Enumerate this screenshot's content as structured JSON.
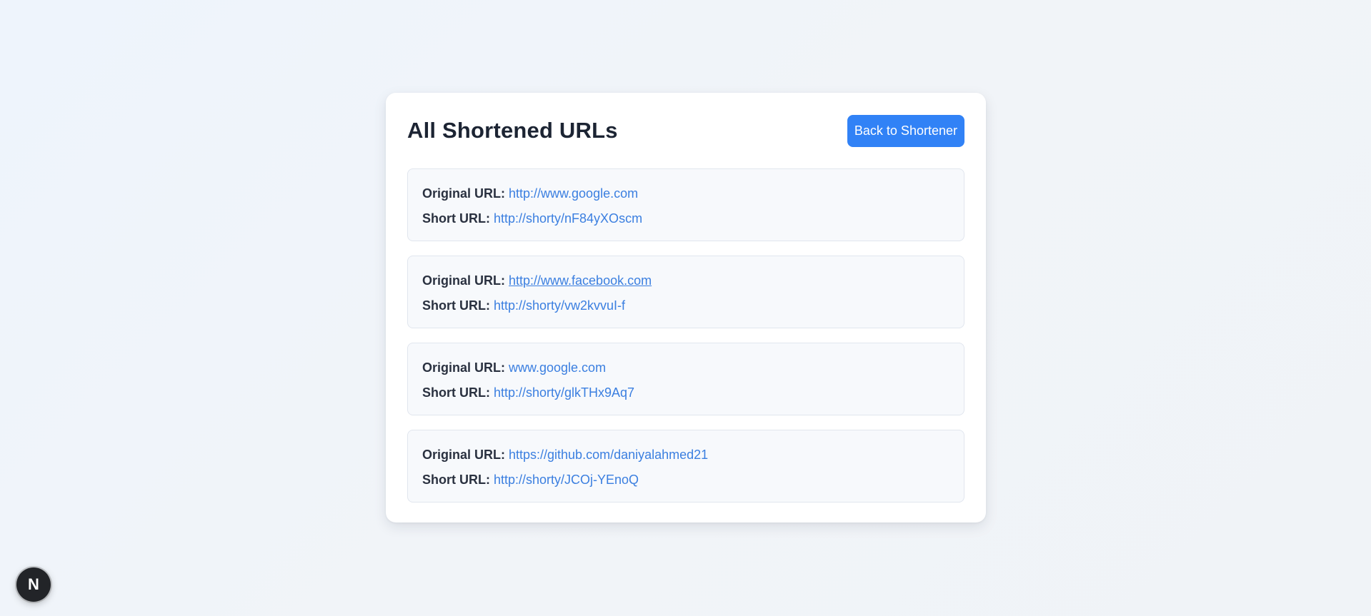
{
  "header": {
    "title": "All Shortened URLs",
    "back_button_label": "Back to Shortener"
  },
  "labels": {
    "original": "Original URL:",
    "short": "Short URL:"
  },
  "urls": [
    {
      "original": "http://www.google.com",
      "short": "http://shorty/nF84yXOscm"
    },
    {
      "original": "http://www.facebook.com",
      "short": "http://shorty/vw2kvvuI-f"
    },
    {
      "original": "www.google.com",
      "short": "http://shorty/glkTHx9Aq7"
    },
    {
      "original": "https://github.com/daniyalahmed21",
      "short": "http://shorty/JCOj-YEnoQ"
    }
  ],
  "badge": {
    "letter": "N",
    "icon": "nextjs-logo-icon"
  },
  "colors": {
    "accent": "#3182f6",
    "link": "#3b7fe0",
    "title": "#1c2433"
  }
}
